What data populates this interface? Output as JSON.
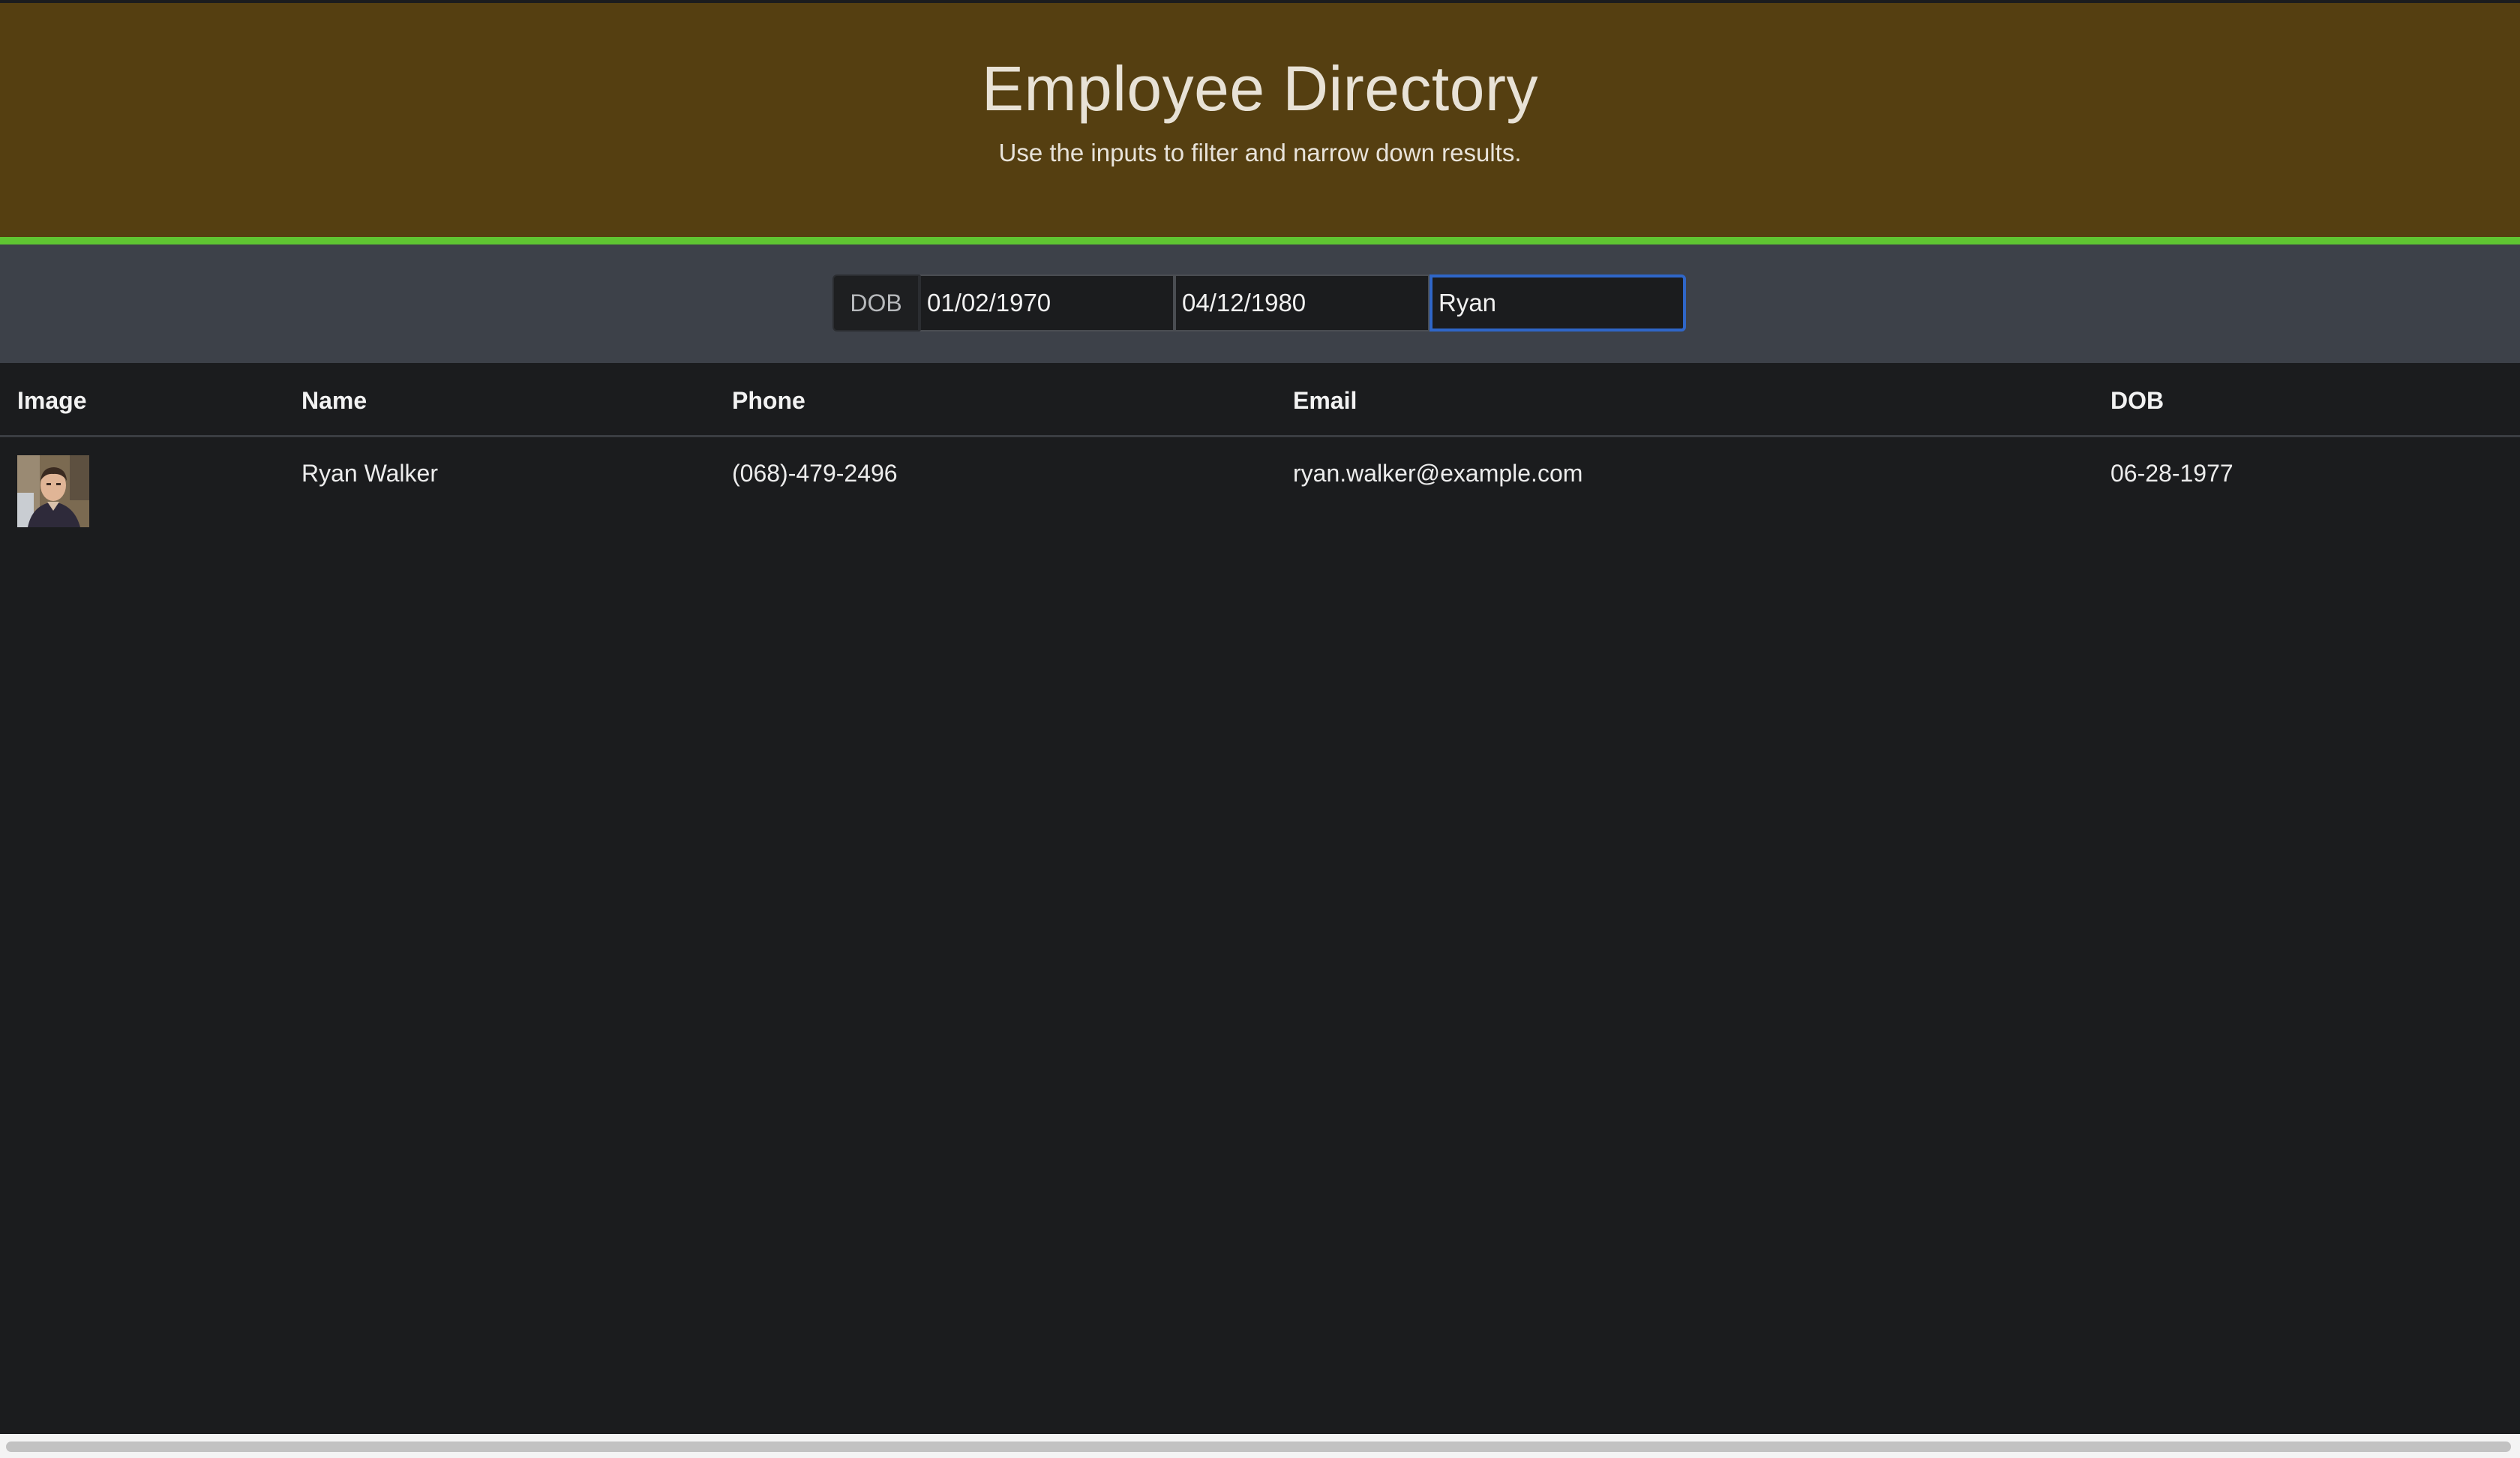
{
  "header": {
    "title": "Employee Directory",
    "subtitle": "Use the inputs to filter and narrow down results."
  },
  "filters": {
    "dob_label": "DOB",
    "start_date": "01/02/1970",
    "end_date": "04/12/1980",
    "name_query": "Ryan"
  },
  "table": {
    "columns": [
      "Image",
      "Name",
      "Phone",
      "Email",
      "DOB"
    ],
    "rows": [
      {
        "image_icon": "employee-photo",
        "name": "Ryan Walker",
        "phone": "(068)-479-2496",
        "email": "ryan.walker@example.com",
        "dob": "06-28-1977"
      }
    ]
  },
  "colors": {
    "header_bg": "#553f11",
    "accent": "#5fc532",
    "filter_bg": "#3d4149",
    "page_bg": "#1b1c1e",
    "focus_border": "#2f66c8"
  }
}
